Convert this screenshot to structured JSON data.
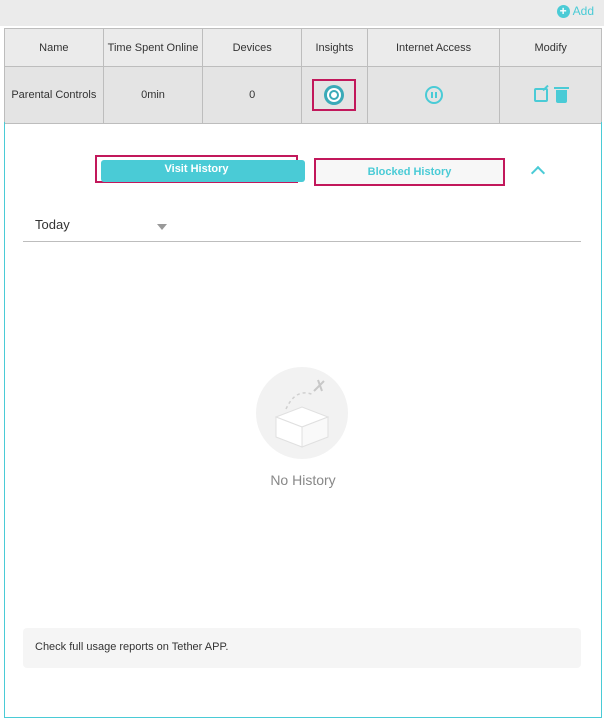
{
  "toolbar": {
    "add_label": "Add",
    "add_icon": "plus-circle-icon"
  },
  "table": {
    "headers": [
      "Name",
      "Time Spent Online",
      "Devices",
      "Insights",
      "Internet Access",
      "Modify"
    ],
    "row": {
      "name": "Parental Controls",
      "time_online": "0min",
      "devices": "0"
    }
  },
  "tabs": {
    "visit": "Visit History",
    "blocked": "Blocked History"
  },
  "filter": {
    "selected": "Today"
  },
  "empty": {
    "text": "No History",
    "icon": "empty-box-icon"
  },
  "note": {
    "text": "Check full usage reports on Tether APP."
  },
  "colors": {
    "accent": "#4acbd6",
    "highlight": "#c2185b"
  }
}
